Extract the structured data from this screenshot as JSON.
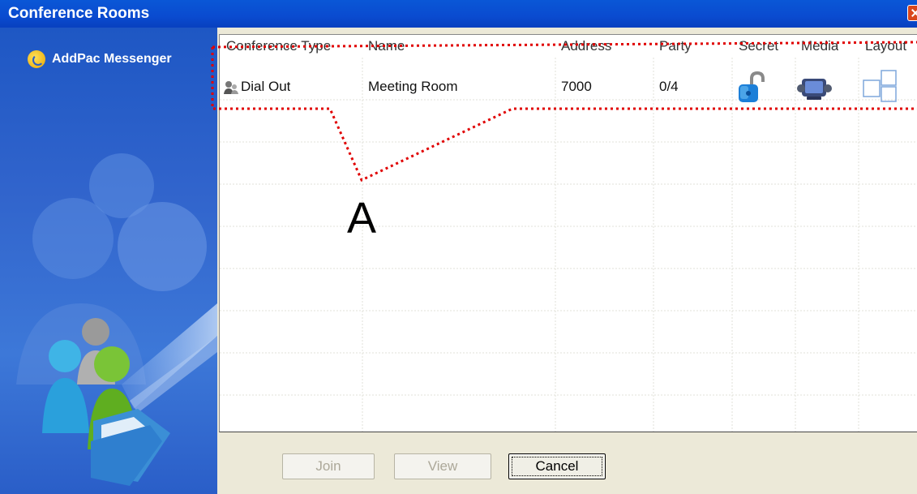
{
  "window": {
    "title": "Conference Rooms"
  },
  "sidebar": {
    "brand": "AddPac Messenger"
  },
  "table": {
    "columns": [
      "Conference Type",
      "Name",
      "Address",
      "Party",
      "Secret",
      "Media",
      "Layout"
    ],
    "rows": [
      {
        "conference_type": "Dial Out",
        "conference_type_icon": "dial-out-icon",
        "name": "Meeting Room",
        "address": "7000",
        "party": "0/4",
        "secret_icon": "unlocked-padlock-icon",
        "media_icon": "media-device-icon",
        "layout_icon": "layout-grid-icon"
      }
    ]
  },
  "annotation": {
    "label": "A",
    "color": "#e00000"
  },
  "buttons": {
    "join": "Join",
    "view": "View",
    "cancel": "Cancel"
  },
  "colors": {
    "titlebar": "#0a4bd0",
    "sidebar": "#2f63cc",
    "dialog_bg": "#ece9d8"
  }
}
